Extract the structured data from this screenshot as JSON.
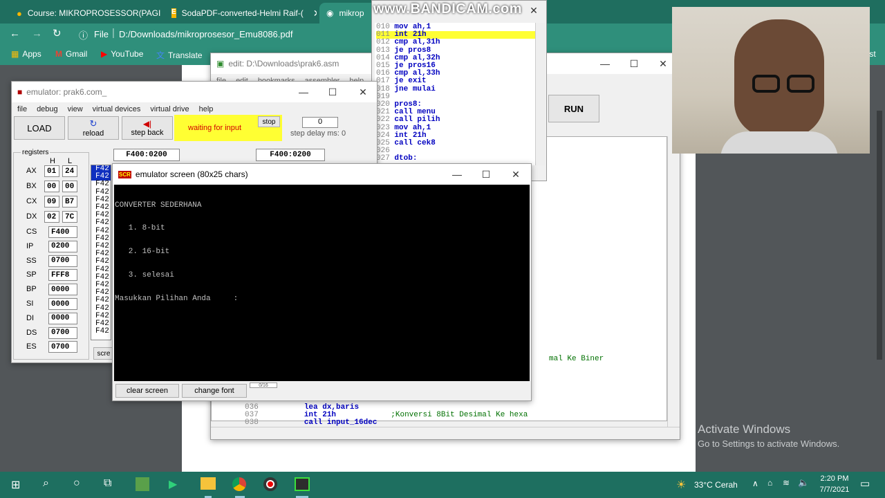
{
  "browser": {
    "tabs": [
      {
        "label": "Course: MIKROPROSESSOR(PAGI",
        "icon": "moodle-icon"
      },
      {
        "label": "SodaPDF-converted-Helmi Raif-(",
        "icon": "pdf-icon"
      },
      {
        "label": "mikrop",
        "icon": "chrome-icon"
      }
    ],
    "url_scheme": "File",
    "url": "D:/Downloads/mikroprosesor_Emu8086.pdf",
    "bookmarks": [
      "Apps",
      "Gmail",
      "YouTube",
      "Translate"
    ],
    "bookmarks_more": "list"
  },
  "watermark": "www.BANDICAM.com",
  "editor": {
    "title": "edit: D:\\Downloads\\prak6.asm",
    "menu": [
      "file",
      "edit",
      "bookmarks",
      "assembler",
      "help"
    ],
    "run_label": "RUN",
    "code_top": [
      {
        "n": "010",
        "t": "mov ah,1"
      },
      {
        "n": "011",
        "t": "int 21h"
      },
      {
        "n": "012",
        "t": "cmp al,31h"
      },
      {
        "n": "013",
        "t": "je pros8"
      },
      {
        "n": "014",
        "t": "cmp al,32h"
      },
      {
        "n": "015",
        "t": "je pros16"
      },
      {
        "n": "016",
        "t": "cmp al,33h"
      },
      {
        "n": "017",
        "t": "je exit"
      },
      {
        "n": "018",
        "t": "jne mulai"
      },
      {
        "n": "019",
        "t": ""
      },
      {
        "n": "020",
        "t": "pros8:"
      },
      {
        "n": "021",
        "t": "call menu"
      },
      {
        "n": "022",
        "t": "call pilih"
      },
      {
        "n": "023",
        "t": "mov ah,1"
      },
      {
        "n": "024",
        "t": "int 21h"
      },
      {
        "n": "025",
        "t": "call cek8"
      },
      {
        "n": "026",
        "t": ""
      },
      {
        "n": "027",
        "t": "dtob:"
      }
    ],
    "code_comment1": "mal Ke Biner",
    "code_bottom": [
      {
        "n": "036",
        "t": "lea dx,baris",
        "c": ""
      },
      {
        "n": "037",
        "t": "int 21h",
        "c": ";Konversi 8Bit Desimal Ke hexa"
      },
      {
        "n": "038",
        "t": "call input_16dec",
        "c": ""
      }
    ]
  },
  "emulator": {
    "title": "emulator: prak6.com_",
    "menu": [
      "file",
      "debug",
      "view",
      "virtual devices",
      "virtual drive",
      "help"
    ],
    "load_label": "LOAD",
    "reload_label": "reload",
    "stepback_label": "step back",
    "status": "waiting for input",
    "stop_label": "stop",
    "step_delay_value": "0",
    "step_delay_label": "step delay ms: 0",
    "addr1": "F400:0200",
    "addr2": "F400:0200",
    "registers_label": "registers",
    "h_label": "H",
    "l_label": "L",
    "split_regs": [
      {
        "name": "AX",
        "h": "01",
        "l": "24"
      },
      {
        "name": "BX",
        "h": "00",
        "l": "00"
      },
      {
        "name": "CX",
        "h": "09",
        "l": "B7"
      },
      {
        "name": "DX",
        "h": "02",
        "l": "7C"
      }
    ],
    "regs": [
      {
        "name": "CS",
        "v": "F400"
      },
      {
        "name": "IP",
        "v": "0200"
      },
      {
        "name": "SS",
        "v": "0700"
      },
      {
        "name": "SP",
        "v": "FFF8"
      },
      {
        "name": "BP",
        "v": "0000"
      },
      {
        "name": "SI",
        "v": "0000"
      },
      {
        "name": "DI",
        "v": "0000"
      },
      {
        "name": "DS",
        "v": "0700"
      },
      {
        "name": "ES",
        "v": "0700"
      }
    ],
    "mem_prefix": "F42",
    "screen_btn": "scre"
  },
  "screen": {
    "title": "emulator screen (80x25 chars)",
    "lines": [
      "CONVERTER SEDERHANA",
      "   1. 8-bit",
      "   2. 16-bit",
      "   3. selesai",
      "Masukkan Pilihan Anda     :"
    ],
    "clear_label": "clear screen",
    "font_label": "change font",
    "counter": "0/16"
  },
  "activate": {
    "title": "Activate Windows",
    "sub": "Go to Settings to activate Windows."
  },
  "taskbar": {
    "weather": "33°C  Cerah",
    "time": "2:20 PM",
    "date": "7/7/2021"
  }
}
